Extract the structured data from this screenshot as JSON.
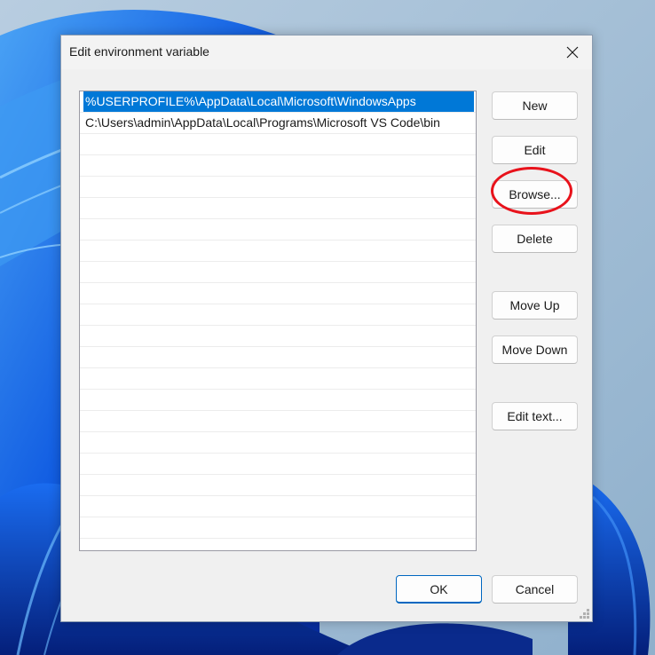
{
  "desktop": {
    "wallpaper": "Windows 11 bloom",
    "colors": {
      "sky": "#9cb9d3",
      "bloom_dark": "#0a2fa8",
      "bloom_light": "#3b8ef0"
    }
  },
  "dialog": {
    "title": "Edit environment variable",
    "close_icon": "close-icon",
    "path_entries": [
      {
        "value": "%USERPROFILE%\\AppData\\Local\\Microsoft\\WindowsApps",
        "selected": true
      },
      {
        "value": "C:\\Users\\admin\\AppData\\Local\\Programs\\Microsoft VS Code\\bin",
        "selected": false
      }
    ],
    "buttons": {
      "new": "New",
      "edit": "Edit",
      "browse": "Browse...",
      "delete": "Delete",
      "move_up": "Move Up",
      "move_down": "Move Down",
      "edit_text": "Edit text...",
      "ok": "OK",
      "cancel": "Cancel"
    },
    "annotation": {
      "target": "Browse...",
      "color": "#e8121b"
    },
    "selection_color": "#0078d7"
  }
}
